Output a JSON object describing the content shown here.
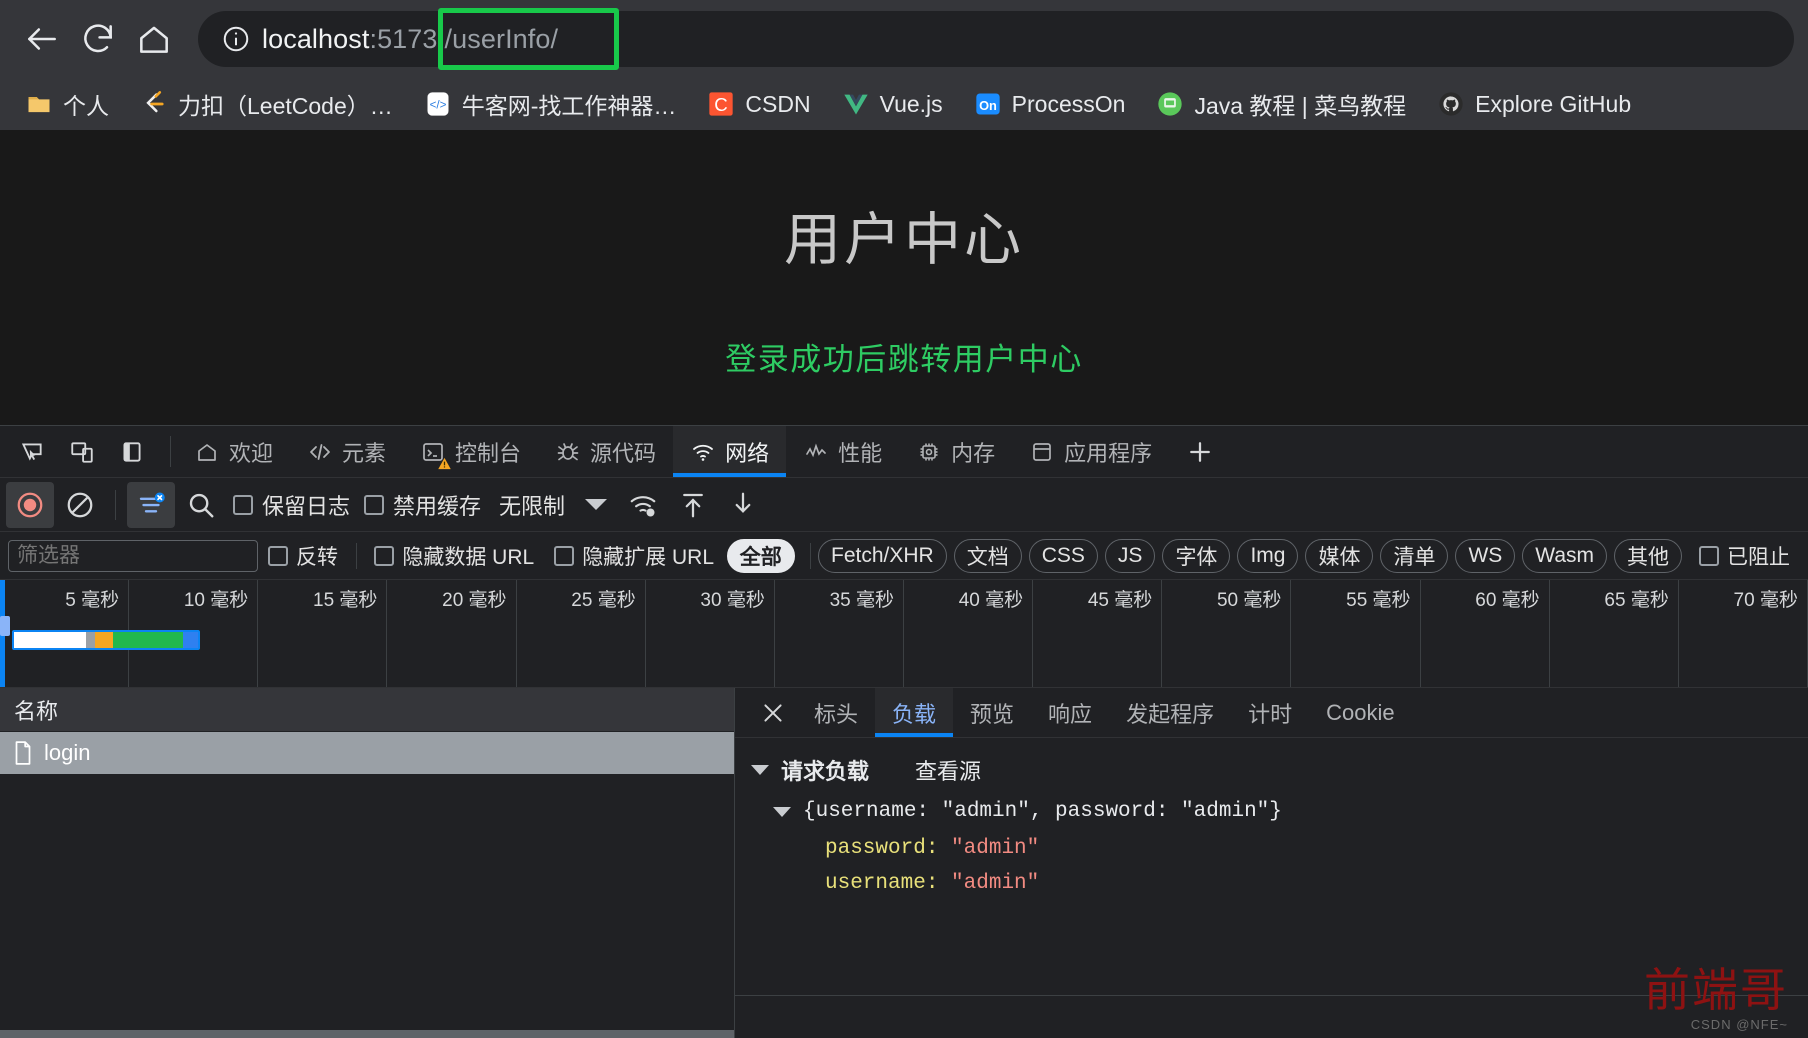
{
  "browser": {
    "nav": {
      "back": "back-arrow",
      "reload": "reload",
      "home": "home"
    },
    "omnibox": {
      "info_icon": "info-circle",
      "host": "localhost",
      "port": ":5173",
      "path": "/userInfo/",
      "highlight_color": "#18c94a"
    },
    "bookmarks": [
      {
        "label": "个人",
        "icon": "folder-icon"
      },
      {
        "label": "力扣（LeetCode）…",
        "icon": "leetcode-icon"
      },
      {
        "label": "牛客网-找工作神器…",
        "icon": "nowcoder-icon"
      },
      {
        "label": "CSDN",
        "icon": "csdn-icon"
      },
      {
        "label": "Vue.js",
        "icon": "vuejs-icon"
      },
      {
        "label": "ProcessOn",
        "icon": "processon-icon"
      },
      {
        "label": "Java 教程 | 菜鸟教程",
        "icon": "runoob-icon"
      },
      {
        "label": "Explore GitHub",
        "icon": "github-icon"
      }
    ]
  },
  "page": {
    "title": "用户中心",
    "subtitle": "登录成功后跳转用户中心",
    "subtitle_color": "#2ecc63"
  },
  "devtools": {
    "left_icons": [
      "inspect-element-icon",
      "device-toolbar-icon",
      "dock-side-icon"
    ],
    "tabs": [
      {
        "label": "欢迎",
        "icon": "home-icon",
        "active": false
      },
      {
        "label": "元素",
        "icon": "code-brackets-icon",
        "active": false
      },
      {
        "label": "控制台",
        "icon": "console-icon",
        "active": false,
        "badge": "warning"
      },
      {
        "label": "源代码",
        "icon": "bug-icon",
        "active": false
      },
      {
        "label": "网络",
        "icon": "wifi-icon",
        "active": true
      },
      {
        "label": "性能",
        "icon": "performance-icon",
        "active": false
      },
      {
        "label": "内存",
        "icon": "memory-chip-icon",
        "active": false
      },
      {
        "label": "应用程序",
        "icon": "application-icon",
        "active": false
      }
    ],
    "add_tab": "plus-icon",
    "network_toolbar": {
      "record": "record-stop-icon",
      "clear": "clear-icon",
      "filter": "filter-icon",
      "search": "search-icon",
      "preserve_log": "保留日志",
      "disable_cache": "禁用缓存",
      "throttle_value": "无限制",
      "throttle_settings": "network-conditions-icon",
      "import_har": "upload-arrow-icon",
      "export_har": "download-arrow-icon"
    },
    "filter_bar": {
      "filter_placeholder": "筛选器",
      "invert": "反转",
      "hide_data_urls": "隐藏数据 URL",
      "hide_extension_urls": "隐藏扩展 URL",
      "types": [
        "全部",
        "Fetch/XHR",
        "文档",
        "CSS",
        "JS",
        "字体",
        "Img",
        "媒体",
        "清单",
        "WS",
        "Wasm",
        "其他"
      ],
      "active_type": "全部",
      "blocked": "已阻止"
    },
    "timeline": {
      "ticks": [
        "5 毫秒",
        "10 毫秒",
        "15 毫秒",
        "20 毫秒",
        "25 毫秒",
        "30 毫秒",
        "35 毫秒",
        "40 毫秒",
        "45 毫秒",
        "50 毫秒",
        "55 毫秒",
        "60 毫秒",
        "65 毫秒",
        "70 毫秒"
      ],
      "bar_segments": [
        {
          "name": "queueing",
          "color": "#ffffff",
          "pct": 39
        },
        {
          "name": "stalled",
          "color": "#9aa0a6",
          "pct": 5
        },
        {
          "name": "waiting",
          "color": "#f5a623",
          "pct": 10
        },
        {
          "name": "content-download",
          "color": "#21b84d",
          "pct": 38
        },
        {
          "name": "finish",
          "color": "#2f80f0",
          "pct": 8
        }
      ]
    },
    "request_list": {
      "column_header": "名称",
      "rows": [
        {
          "name": "login",
          "icon": "document-icon",
          "selected": true
        }
      ]
    },
    "detail": {
      "close": "close-icon",
      "tabs": [
        "标头",
        "负载",
        "预览",
        "响应",
        "发起程序",
        "计时",
        "Cookie"
      ],
      "active_tab": "负载",
      "payload": {
        "section_title": "请求负载",
        "view_source": "查看源",
        "object_preview": "{username: \"admin\", password: \"admin\"}",
        "entries": [
          {
            "key": "password:",
            "value": "\"admin\""
          },
          {
            "key": "username:",
            "value": "\"admin\""
          }
        ]
      }
    }
  },
  "watermark": {
    "main": "前端哥",
    "sub": "CSDN @NFE~"
  }
}
